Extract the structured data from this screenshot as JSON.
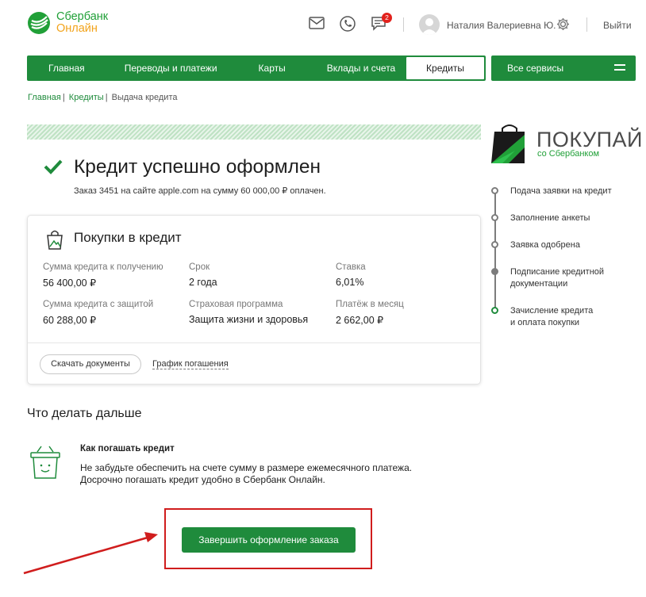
{
  "header": {
    "logo_line1": "Сбербанк",
    "logo_line2": "Онлайн",
    "messages_count": "2",
    "user_name": "Наталия Валериевна Ю.",
    "logout": "Выйти"
  },
  "nav": {
    "items": [
      "Главная",
      "Переводы и платежи",
      "Карты",
      "Вклады и счета"
    ],
    "active": "Кредиты",
    "all_services": "Все сервисы"
  },
  "breadcrumb": {
    "home": "Главная",
    "credits": "Кредиты",
    "current": "Выдача кредита"
  },
  "success": {
    "title": "Кредит успешно оформлен",
    "subtitle": "Заказ 3451 на сайте apple.com на сумму 60 000,00 ₽ оплачен."
  },
  "card": {
    "title": "Покупки в кредит",
    "fields": [
      {
        "label": "Сумма кредита к получению",
        "value": "56 400,00 ₽"
      },
      {
        "label": "Срок",
        "value": "2 года"
      },
      {
        "label": "Ставка",
        "value": "6,01%"
      },
      {
        "label": "Сумма кредита с защитой",
        "value": "60 288,00 ₽"
      },
      {
        "label": "Страховая программа",
        "value": "Защита жизни и здоровья"
      },
      {
        "label": "Платёж в месяц",
        "value": "2 662,00 ₽"
      }
    ],
    "download_button": "Скачать документы",
    "schedule_link": "График погашения"
  },
  "next_steps": {
    "title": "Что делать дальше",
    "tip_title": "Как погашать кредит",
    "tip_line1": "Не забудьте обеспечить на счете сумму в размере ежемесячного платежа.",
    "tip_line2": "Досрочно погашать кредит удобно в Сбербанк Онлайн."
  },
  "finish_button": "Завершить оформление заказа",
  "brand": {
    "name": "ПОКУПАЙ",
    "sub": "со Сбербанком"
  },
  "steps": [
    {
      "line1": "Подача заявки на кредит",
      "line2": ""
    },
    {
      "line1": "Заполнение анкеты",
      "line2": ""
    },
    {
      "line1": "Заявка одобрена",
      "line2": ""
    },
    {
      "line1": "Подписание кредитной",
      "line2": "документации"
    },
    {
      "line1": "Зачисление кредита",
      "line2": "и оплата покупки"
    }
  ],
  "colors": {
    "brand_green": "#1f8b3c",
    "accent_orange": "#f2a31b",
    "alert_red": "#d01d1d"
  },
  "icons": [
    "sberbank-logo-icon",
    "mail-icon",
    "phone-icon",
    "chat-icon",
    "user-avatar-icon",
    "settings-gear-icon",
    "menu-icon",
    "check-icon",
    "shopping-bag-icon",
    "basket-icon",
    "pokupay-logo-icon"
  ]
}
